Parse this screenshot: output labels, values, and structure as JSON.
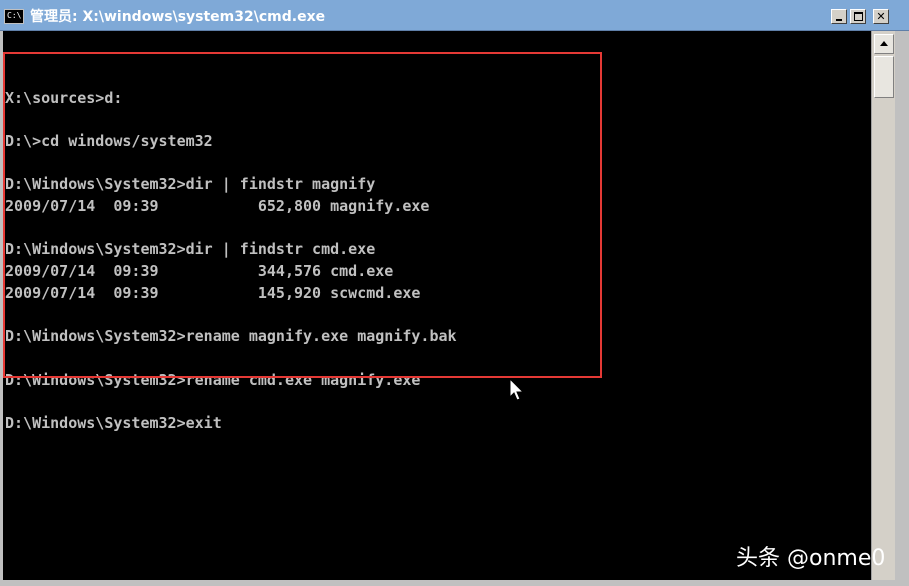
{
  "window": {
    "title": "管理员: X:\\windows\\system32\\cmd.exe",
    "icon_text": "C:\\",
    "buttons": {
      "minimize": "minimize",
      "maximize": "maximize",
      "close": "✕"
    }
  },
  "console": {
    "lines": [
      {
        "text": "X:\\sources>d:"
      },
      {
        "text": ""
      },
      {
        "text": "D:\\>cd windows/system32"
      },
      {
        "text": ""
      },
      {
        "text": "D:\\Windows\\System32>dir | findstr magnify"
      },
      {
        "text": "2009/07/14  09:39           652,800 magnify.exe"
      },
      {
        "text": ""
      },
      {
        "text": "D:\\Windows\\System32>dir | findstr cmd.exe"
      },
      {
        "text": "2009/07/14  09:39           344,576 cmd.exe"
      },
      {
        "text": "2009/07/14  09:39           145,920 scwcmd.exe"
      },
      {
        "text": ""
      },
      {
        "text": "D:\\Windows\\System32>rename magnify.exe magnify.bak"
      },
      {
        "text": ""
      },
      {
        "text": "D:\\Windows\\System32>rename cmd.exe magnify.exe"
      },
      {
        "text": ""
      },
      {
        "text": "D:\\Windows\\System32>exit"
      }
    ]
  },
  "watermark": "头条 @onme0",
  "colors": {
    "highlight_border": "#e53935",
    "console_text": "#c0c0c0",
    "titlebar": "#7fa9d7"
  }
}
